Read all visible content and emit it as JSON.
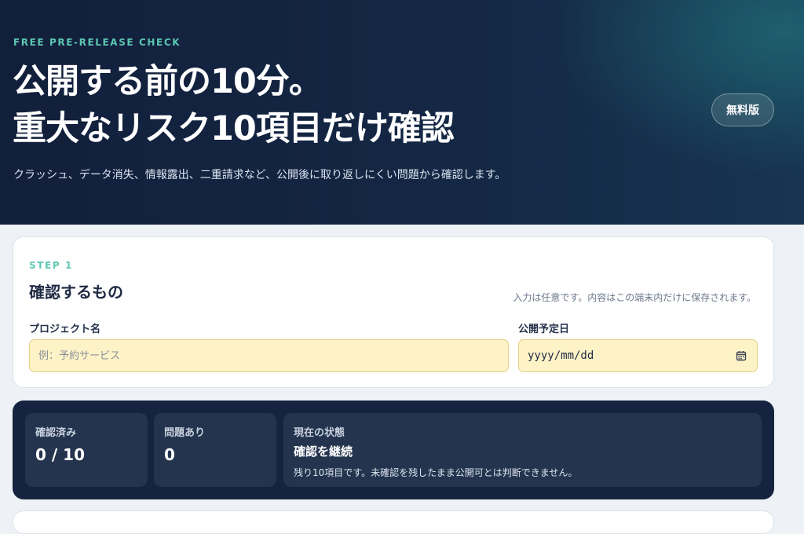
{
  "hero": {
    "eyebrow": "FREE PRE-RELEASE CHECK",
    "title_line1": "公開する前の10分。",
    "title_line2": "重大なリスク10項目だけ確認",
    "subtitle": "クラッシュ、データ消失、情報露出、二重請求など、公開後に取り返しにくい問題から確認します。",
    "badge": "無料版"
  },
  "step": {
    "label": "STEP 1",
    "title": "確認するもの",
    "note": "入力は任意です。内容はこの端末内だけに保存されます。",
    "project_label": "プロジェクト名",
    "project_placeholder": "例：予約サービス",
    "project_value": "",
    "date_label": "公開予定日",
    "date_value": "yyyy/mm/dd",
    "date_icon": "calendar-icon"
  },
  "status": {
    "checked_label": "確認済み",
    "checked_value": "0 / 10",
    "issues_label": "問題あり",
    "issues_value": "0",
    "state_label": "現在の状態",
    "state_value": "確認を継続",
    "state_desc": "残り10項目です。未確認を残したまま公開可とは判断できません。"
  },
  "colors": {
    "hero_bg": "#132240",
    "accent_teal": "#5cc7b2",
    "input_bg": "#fef3c7",
    "status_bg": "#152340",
    "tile_bg": "#25344e"
  }
}
